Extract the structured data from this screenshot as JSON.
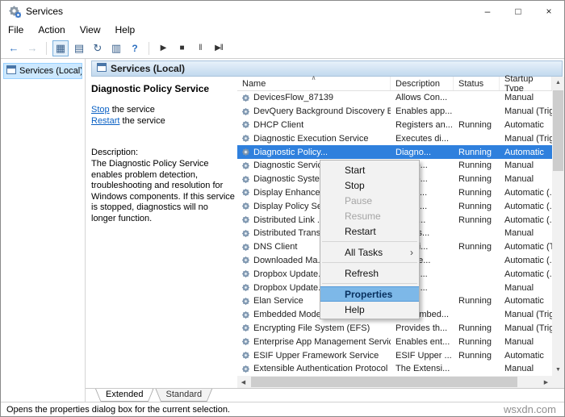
{
  "window": {
    "title": "Services",
    "controls": {
      "minimize": "–",
      "maximize": "□",
      "close": "×"
    }
  },
  "menubar": {
    "items": [
      "File",
      "Action",
      "View",
      "Help"
    ]
  },
  "toolbar": {
    "icons": [
      {
        "name": "back",
        "glyph": "←",
        "style": "enabled-blue"
      },
      {
        "name": "forward",
        "glyph": "→",
        "style": "disabled"
      },
      {
        "name": "separator"
      },
      {
        "name": "show-console-tree",
        "glyph": "▦",
        "style": "toggled"
      },
      {
        "name": "properties",
        "glyph": "▤",
        "style": ""
      },
      {
        "name": "refresh",
        "glyph": "↻",
        "style": ""
      },
      {
        "name": "export-list",
        "glyph": "▥",
        "style": ""
      },
      {
        "name": "help",
        "glyph": "?",
        "style": "help"
      },
      {
        "name": "separator"
      },
      {
        "name": "start-service",
        "glyph": "▶",
        "style": "media"
      },
      {
        "name": "stop-service",
        "glyph": "■",
        "style": "media"
      },
      {
        "name": "pause-service",
        "glyph": "‖",
        "style": "media"
      },
      {
        "name": "restart-service",
        "glyph": "▶‖",
        "style": "media"
      }
    ]
  },
  "sidebar": {
    "root_label": "Services (Local)"
  },
  "panel_header": {
    "title": "Services (Local)"
  },
  "detail_panel": {
    "title": "Diagnostic Policy Service",
    "links": [
      {
        "action": "Stop",
        "suffix": " the service"
      },
      {
        "action": "Restart",
        "suffix": " the service"
      }
    ],
    "description_label": "Description:",
    "description": "The Diagnostic Policy Service enables problem detection, troubleshooting and resolution for Windows components.  If this service is stopped, diagnostics will no longer function."
  },
  "table": {
    "columns": [
      "Name",
      "Description",
      "Status",
      "Startup Type"
    ],
    "rows": [
      {
        "name": "DevicesFlow_87139",
        "description": "Allows Con...",
        "status": "",
        "startup": "Manual",
        "selected": false
      },
      {
        "name": "DevQuery Background Discovery B...",
        "description": "Enables app...",
        "status": "",
        "startup": "Manual (Trig...",
        "selected": false
      },
      {
        "name": "DHCP Client",
        "description": "Registers an...",
        "status": "Running",
        "startup": "Automatic",
        "selected": false
      },
      {
        "name": "Diagnostic Execution Service",
        "description": "Executes di...",
        "status": "",
        "startup": "Manual (Trig...",
        "selected": false
      },
      {
        "name": "Diagnostic Policy...",
        "description": "Diagno...",
        "status": "Running",
        "startup": "Automatic",
        "selected": true
      },
      {
        "name": "Diagnostic Servic...",
        "description": "..agno...",
        "status": "Running",
        "startup": "Manual",
        "selected": false
      },
      {
        "name": "Diagnostic Syste...",
        "description": "..agno...",
        "status": "Running",
        "startup": "Manual",
        "selected": false
      },
      {
        "name": "Display Enhance...",
        "description": "..ce fo...",
        "status": "Running",
        "startup": "Automatic (...",
        "selected": false
      },
      {
        "name": "Display Policy Se...",
        "description": "..es th...",
        "status": "Running",
        "startup": "Automatic (...",
        "selected": false
      },
      {
        "name": "Distributed Link ...",
        "description": "..ins li...",
        "status": "Running",
        "startup": "Automatic (...",
        "selected": false
      },
      {
        "name": "Distributed Trans...",
        "description": "..nates...",
        "status": "",
        "startup": "Manual",
        "selected": false
      },
      {
        "name": "DNS Client",
        "description": "NS Cli...",
        "status": "Running",
        "startup": "Automatic (T...",
        "selected": false
      },
      {
        "name": "Downloaded Ma...",
        "description": "..ws se...",
        "status": "",
        "startup": "Automatic (...",
        "selected": false
      },
      {
        "name": "Dropbox Update...",
        "description": "..your ...",
        "status": "",
        "startup": "Automatic (...",
        "selected": false
      },
      {
        "name": "Dropbox Update...",
        "description": "..your ...",
        "status": "",
        "startup": "Manual",
        "selected": false
      },
      {
        "name": "Elan Service",
        "description": "",
        "status": "Running",
        "startup": "Automatic",
        "selected": false
      },
      {
        "name": "Embedded Mode",
        "description": "The Embed...",
        "status": "",
        "startup": "Manual (Trig...",
        "selected": false
      },
      {
        "name": "Encrypting File System (EFS)",
        "description": "Provides th...",
        "status": "Running",
        "startup": "Manual (Trig...",
        "selected": false
      },
      {
        "name": "Enterprise App Management Service",
        "description": "Enables ent...",
        "status": "Running",
        "startup": "Manual",
        "selected": false
      },
      {
        "name": "ESIF Upper Framework Service",
        "description": "ESIF Upper ...",
        "status": "Running",
        "startup": "Automatic",
        "selected": false
      },
      {
        "name": "Extensible Authentication Protocol",
        "description": "The Extensi...",
        "status": "",
        "startup": "Manual",
        "selected": false
      }
    ]
  },
  "context_menu": {
    "items": [
      {
        "label": "Start"
      },
      {
        "label": "Stop"
      },
      {
        "label": "Pause",
        "disabled": true
      },
      {
        "label": "Resume",
        "disabled": true
      },
      {
        "label": "Restart"
      },
      {
        "separator": true
      },
      {
        "label": "All Tasks",
        "submenu": true
      },
      {
        "separator": true
      },
      {
        "label": "Refresh"
      },
      {
        "separator": true
      },
      {
        "label": "Properties",
        "highlighted": true
      },
      {
        "label": "Help"
      }
    ],
    "submenu_arrow": "›"
  },
  "tabs": [
    {
      "label": "Extended",
      "active": true
    },
    {
      "label": "Standard",
      "active": false
    }
  ],
  "statusbar": {
    "text": "Opens the properties dialog box for the current selection."
  },
  "watermark": "wsxdn.com"
}
